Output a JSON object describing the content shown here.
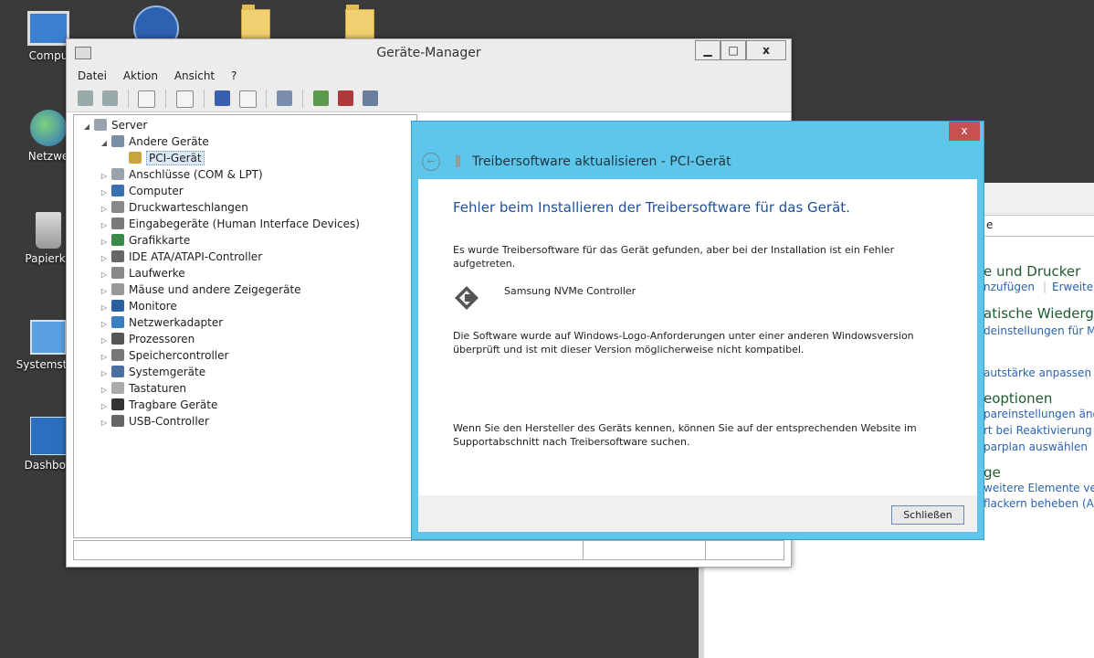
{
  "desktop": {
    "icons": [
      {
        "label": "Compu"
      },
      {
        "label": "Netzwe"
      },
      {
        "label": "Papierko"
      },
      {
        "label": "Systemsteu"
      },
      {
        "label": "Dashboa"
      }
    ]
  },
  "control_panel": {
    "search_fragment": "e",
    "items": [
      {
        "text": "e und Drucker",
        "kind": "heading"
      },
      {
        "text": "nzufügen",
        "kind": "link"
      },
      {
        "text": "Erweitert",
        "kind": "link"
      },
      {
        "text": "atische Wiedergab",
        "kind": "heading"
      },
      {
        "text": "deinstellungen für Medi",
        "kind": "link"
      },
      {
        "text": "autstärke anpassen",
        "kind": "link"
      },
      {
        "text": "eoptionen",
        "kind": "heading"
      },
      {
        "text": "pareinstellungen änder",
        "kind": "link"
      },
      {
        "text": "rt bei Reaktivierung des",
        "kind": "link"
      },
      {
        "text": "parplan auswählen",
        "kind": "link"
      },
      {
        "text": "ge",
        "kind": "heading"
      },
      {
        "text": " weitere Elemente verg",
        "kind": "link"
      },
      {
        "text": "flackern beheben (Aktu",
        "kind": "link"
      }
    ]
  },
  "device_manager": {
    "title": "Geräte-Manager",
    "controls": {
      "minimize": "▁",
      "maximize": "□",
      "close": "x"
    },
    "menu": [
      "Datei",
      "Aktion",
      "Ansicht",
      "?"
    ],
    "tree": {
      "root": "Server",
      "nodes": [
        {
          "label": "Andere Geräte",
          "expand": "◢",
          "level": 1
        },
        {
          "label": "PCI-Gerät",
          "expand": "",
          "level": 2,
          "selected": true
        },
        {
          "label": "Anschlüsse (COM & LPT)",
          "expand": "▷",
          "level": 1
        },
        {
          "label": "Computer",
          "expand": "▷",
          "level": 1
        },
        {
          "label": "Druckwarteschlangen",
          "expand": "▷",
          "level": 1
        },
        {
          "label": "Eingabegeräte (Human Interface Devices)",
          "expand": "▷",
          "level": 1
        },
        {
          "label": "Grafikkarte",
          "expand": "▷",
          "level": 1
        },
        {
          "label": "IDE ATA/ATAPI-Controller",
          "expand": "▷",
          "level": 1
        },
        {
          "label": "Laufwerke",
          "expand": "▷",
          "level": 1
        },
        {
          "label": "Mäuse und andere Zeigegeräte",
          "expand": "▷",
          "level": 1
        },
        {
          "label": "Monitore",
          "expand": "▷",
          "level": 1
        },
        {
          "label": "Netzwerkadapter",
          "expand": "▷",
          "level": 1
        },
        {
          "label": "Prozessoren",
          "expand": "▷",
          "level": 1
        },
        {
          "label": "Speichercontroller",
          "expand": "▷",
          "level": 1
        },
        {
          "label": "Systemgeräte",
          "expand": "▷",
          "level": 1
        },
        {
          "label": "Tastaturen",
          "expand": "▷",
          "level": 1
        },
        {
          "label": "Tragbare Geräte",
          "expand": "▷",
          "level": 1
        },
        {
          "label": "USB-Controller",
          "expand": "▷",
          "level": 1
        }
      ]
    }
  },
  "wizard": {
    "close": "x",
    "back": "←",
    "title": "Treibersoftware aktualisieren - PCI-Gerät",
    "heading": "Fehler beim Installieren der Treibersoftware für das Gerät.",
    "para1": "Es wurde Treibersoftware für das Gerät gefunden, aber bei der Installation ist ein Fehler aufgetreten.",
    "device_name": "Samsung NVMe Controller",
    "para2": "Die Software wurde auf Windows-Logo-Anforderungen unter einer anderen Windowsversion überprüft und ist mit dieser Version möglicherweise nicht kompatibel.",
    "para3": "Wenn Sie den Hersteller des Geräts kennen, können Sie auf der entsprechenden Website im Supportabschnitt nach Treibersoftware suchen.",
    "close_button": "Schließen"
  }
}
